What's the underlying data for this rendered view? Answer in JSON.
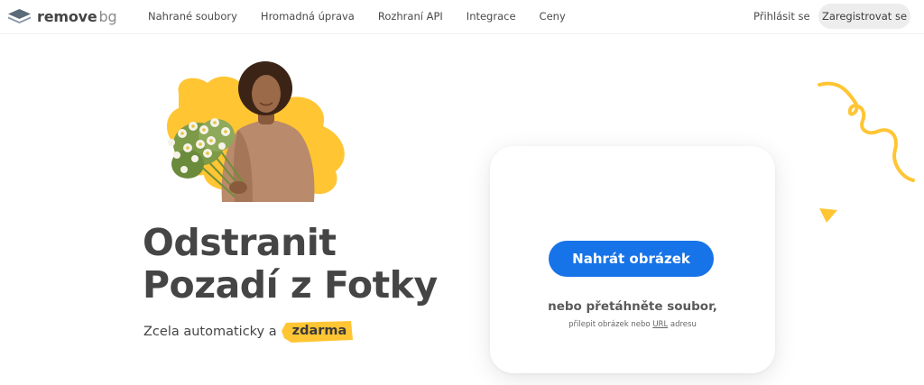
{
  "brand": {
    "name_bold": "remove",
    "name_light": "bg",
    "accent": "#ffc533",
    "primary_button": "#1773e8"
  },
  "nav": {
    "items": [
      {
        "label": "Nahrané soubory"
      },
      {
        "label": "Hromadná úprava"
      },
      {
        "label": "Rozhraní API"
      },
      {
        "label": "Integrace"
      },
      {
        "label": "Ceny"
      }
    ],
    "login": "Přihlásit se",
    "signup": "Zaregistrovat se"
  },
  "hero": {
    "headline_line1": "Odstranit",
    "headline_line2": "Pozadí z Fotky",
    "subline_prefix": "Zcela automaticky a",
    "subline_badge": "zdarma"
  },
  "upload": {
    "button_label": "Nahrát obrázek",
    "drop_text": "nebo přetáhněte soubor,",
    "paste_prefix": "přilepit obrázek nebo",
    "paste_url": "URL",
    "paste_suffix": "adresu"
  }
}
